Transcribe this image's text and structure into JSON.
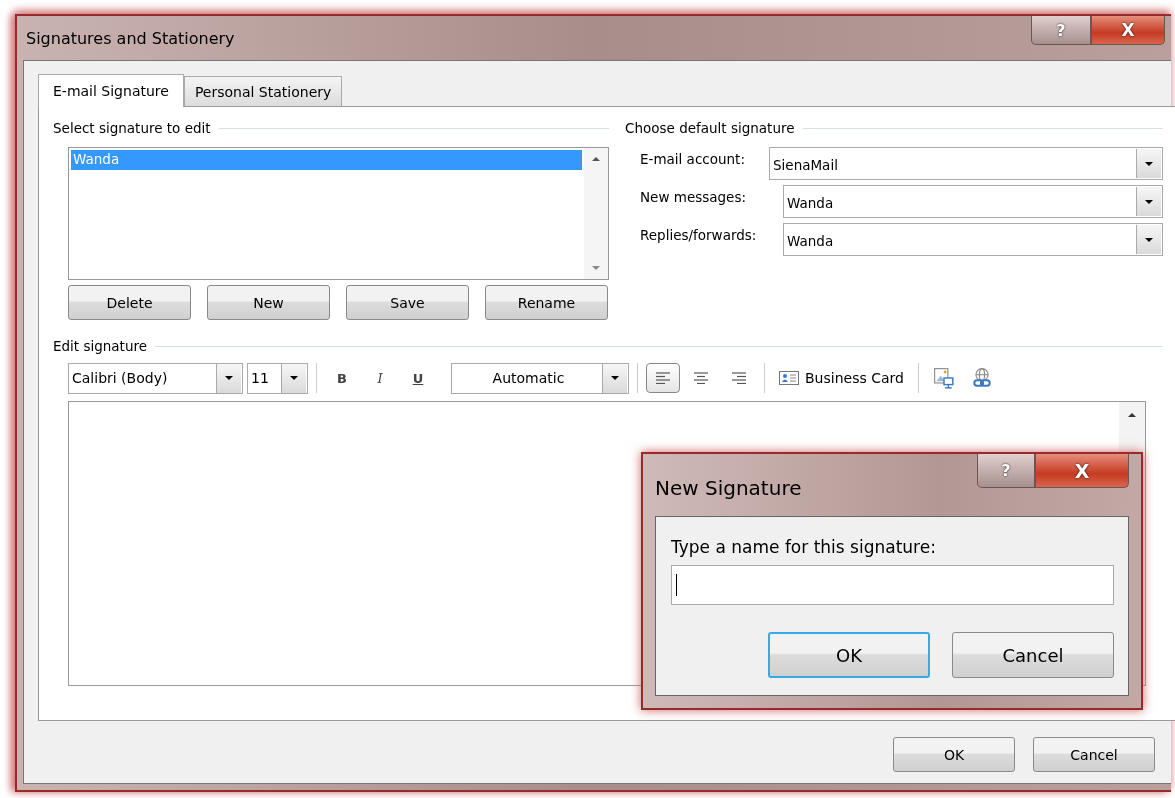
{
  "window": {
    "title": "Signatures and Stationery",
    "controls": [
      {
        "kind": "help",
        "label": "?"
      },
      {
        "kind": "close",
        "label": "X"
      }
    ]
  },
  "tabs": [
    {
      "label": "E-mail Signature",
      "selected": true
    },
    {
      "label": "Personal Stationery",
      "selected": false
    }
  ],
  "select_signature": {
    "heading": "Select signature to edit",
    "items": [
      {
        "label": "Wanda",
        "selected": true
      }
    ],
    "buttons": [
      "Delete",
      "New",
      "Save",
      "Rename"
    ]
  },
  "default_signature": {
    "heading": "Choose default signature",
    "fields": [
      {
        "label": "E-mail account:",
        "value": "SienaMail"
      },
      {
        "label": "New messages:",
        "value": "Wanda"
      },
      {
        "label": "Replies/forwards:",
        "value": "Wanda"
      }
    ]
  },
  "edit_signature": {
    "heading": "Edit signature",
    "font": "Calibri (Body)",
    "size": "11",
    "text_color": "Automatic",
    "format_buttons": [
      {
        "label": "B",
        "kind": "bold"
      },
      {
        "label": "I",
        "kind": "italic"
      },
      {
        "label": "U",
        "kind": "underline"
      }
    ],
    "align": [
      {
        "kind": "left",
        "selected": true
      },
      {
        "kind": "center",
        "selected": false
      },
      {
        "kind": "right",
        "selected": false
      }
    ],
    "business_card": "Business Card"
  },
  "buttons": [
    "OK",
    "Cancel"
  ],
  "new_signature_dialog": {
    "title": "New Signature",
    "controls": [
      {
        "kind": "help",
        "label": "?"
      },
      {
        "kind": "close",
        "label": "X"
      }
    ],
    "prompt": "Type a name for this signature:",
    "buttons": [
      {
        "label": "OK",
        "default": true
      },
      {
        "label": "Cancel",
        "default": false
      }
    ]
  }
}
